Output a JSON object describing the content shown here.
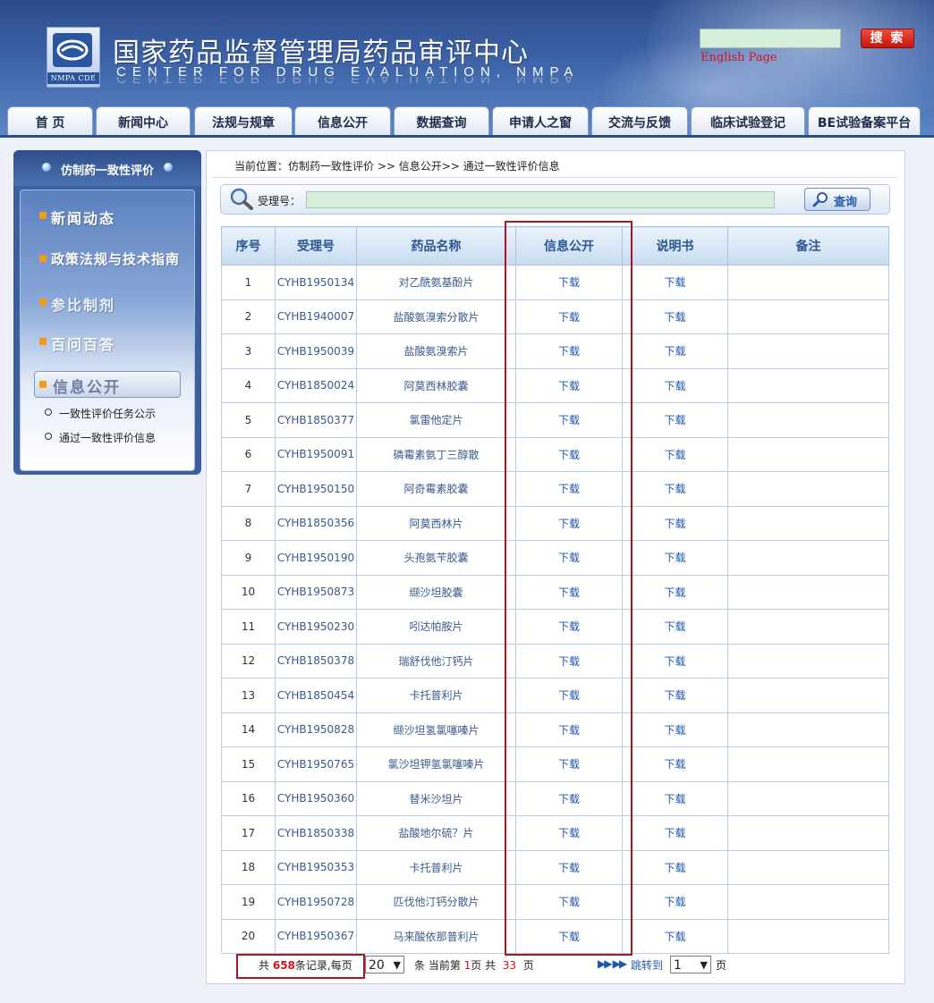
{
  "header": {
    "logo_caption": "NMPA CDE",
    "title_cn": "国家药品监督管理局药品审评中心",
    "title_en": "CENTER FOR DRUG EVALUATION, NMPA",
    "search_button": "搜 索",
    "search_value": "",
    "english_link": "English Page"
  },
  "nav": [
    "首 页",
    "新闻中心",
    "法规与规章",
    "信息公开",
    "数据查询",
    "申请人之窗",
    "交流与反馈",
    "临床试验登记",
    "BE试验备案平台"
  ],
  "sidebar": {
    "title": "仿制药一致性评价",
    "items": [
      "新闻动态",
      "政策法规与技术指南",
      "参比制剂",
      "百问百答"
    ],
    "active": "信息公开",
    "sub_items": [
      "一致性评价任务公示",
      "通过一致性评价信息"
    ]
  },
  "breadcrumb": "当前位置：仿制药一致性评价 >> 信息公开>> 通过一致性评价信息",
  "search": {
    "label": "受理号：",
    "value": "",
    "button": "查询"
  },
  "table": {
    "headers": [
      "序号",
      "受理号",
      "药品名称",
      "信息公开",
      "说明书",
      "备注"
    ],
    "rows": [
      [
        "1",
        "CYHB1950134",
        "对乙酰氨基酚片",
        "下载",
        "下载",
        ""
      ],
      [
        "2",
        "CYHB1940007",
        "盐酸氨溴索分散片",
        "下载",
        "下载",
        ""
      ],
      [
        "3",
        "CYHB1950039",
        "盐酸氨溴索片",
        "下载",
        "下载",
        ""
      ],
      [
        "4",
        "CYHB1850024",
        "阿莫西林胶囊",
        "下载",
        "下载",
        ""
      ],
      [
        "5",
        "CYHB1850377",
        "氯雷他定片",
        "下载",
        "下载",
        ""
      ],
      [
        "6",
        "CYHB1950091",
        "磷霉素氨丁三醇散",
        "下载",
        "下载",
        ""
      ],
      [
        "7",
        "CYHB1950150",
        "阿奇霉素胶囊",
        "下载",
        "下载",
        ""
      ],
      [
        "8",
        "CYHB1850356",
        "阿莫西林片",
        "下载",
        "下载",
        ""
      ],
      [
        "9",
        "CYHB1950190",
        "头孢氨苄胶囊",
        "下载",
        "下载",
        ""
      ],
      [
        "10",
        "CYHB1950873",
        "缬沙坦胶囊",
        "下载",
        "下载",
        ""
      ],
      [
        "11",
        "CYHB1950230",
        "吲达帕胺片",
        "下载",
        "下载",
        ""
      ],
      [
        "12",
        "CYHB1850378",
        "瑞舒伐他汀钙片",
        "下载",
        "下载",
        ""
      ],
      [
        "13",
        "CYHB1850454",
        "卡托普利片",
        "下载",
        "下载",
        ""
      ],
      [
        "14",
        "CYHB1950828",
        "缬沙坦氢氯噻嗪片",
        "下载",
        "下载",
        ""
      ],
      [
        "15",
        "CYHB1950765",
        "氯沙坦钾氢氯噻嗪片",
        "下载",
        "下载",
        ""
      ],
      [
        "16",
        "CYHB1950360",
        "替米沙坦片",
        "下载",
        "下载",
        ""
      ],
      [
        "17",
        "CYHB1850338",
        "盐酸地尔硫？片",
        "下载",
        "下载",
        ""
      ],
      [
        "18",
        "CYHB1950353",
        "卡托普利片",
        "下载",
        "下载",
        ""
      ],
      [
        "19",
        "CYHB1950728",
        "匹伐他汀钙分散片",
        "下载",
        "下载",
        ""
      ],
      [
        "20",
        "CYHB1950367",
        "马来酸依那普利片",
        "下载",
        "下载",
        ""
      ]
    ]
  },
  "pager": {
    "total_prefix": "共",
    "total": "658",
    "total_suffix": "条记录,每页",
    "per_page": "20",
    "per_page_suffix": "条 当前第",
    "current": "1",
    "page_mid": "页 共",
    "pages": "33",
    "pages_suffix": "页",
    "jump_label": "跳转到",
    "jump_value": "1",
    "jump_suffix": "页"
  },
  "colors": {
    "highlight": "#b0141a",
    "accent_red": "#d4121c",
    "brand_blue": "#2c4c8a"
  }
}
